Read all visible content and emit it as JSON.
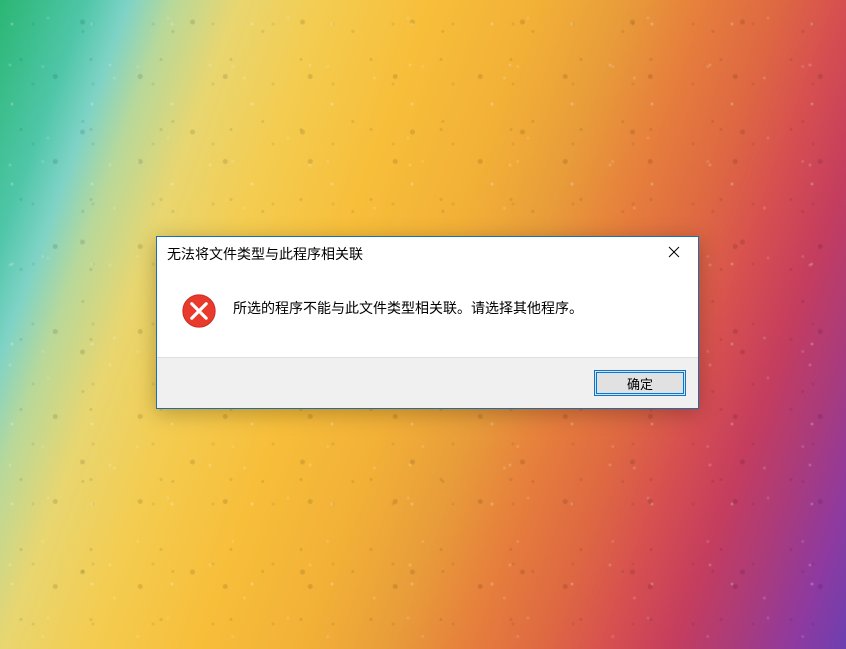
{
  "dialog": {
    "title": "无法将文件类型与此程序相关联",
    "message": "所选的程序不能与此文件类型相关联。请选择其他程序。",
    "ok_label": "确定"
  }
}
